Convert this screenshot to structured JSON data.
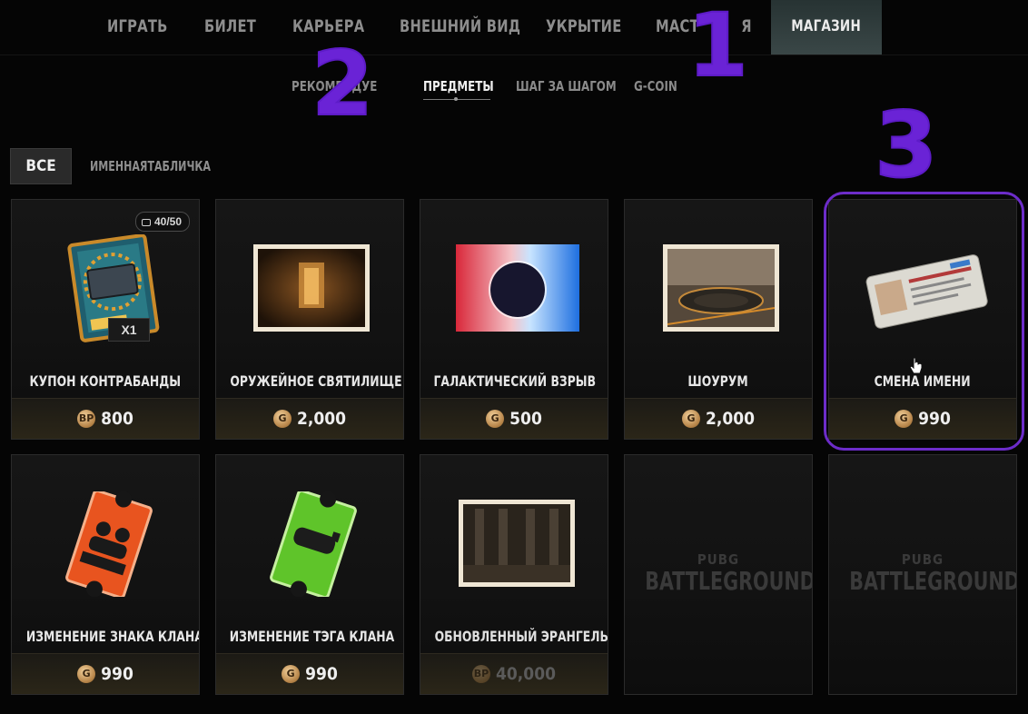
{
  "top_nav": {
    "tabs": [
      {
        "label": "ИГРАТЬ",
        "active": false
      },
      {
        "label": "БИЛЕТ",
        "active": false
      },
      {
        "label": "КАРЬЕРА",
        "active": false
      },
      {
        "label": "ВНЕШНИЙ ВИД",
        "active": false
      },
      {
        "label": "УКРЫТИЕ",
        "active": false
      },
      {
        "label": "МАСТ",
        "active": false,
        "suffix": "Я"
      },
      {
        "label": "МАГАЗИН",
        "active": true
      }
    ]
  },
  "sub_nav": {
    "tabs": [
      {
        "label": "РЕКОМЕНДУЕ",
        "active": false
      },
      {
        "label": "ПРЕДМЕТЫ",
        "active": true
      },
      {
        "label": "ШАГ ЗА ШАГОМ",
        "active": false
      },
      {
        "label": "G-COIN",
        "active": false
      }
    ]
  },
  "filters": {
    "all": "ВСЕ",
    "nameplate": "ИМЕННАЯТАБЛИЧКА"
  },
  "items": [
    {
      "name": "КУПОН КОНТРАБАНДЫ",
      "currency": "BP",
      "price": "800",
      "badge": "40/50",
      "qty": "X1"
    },
    {
      "name": "ОРУЖЕЙНОЕ СВЯТИЛИЩЕ",
      "currency": "G",
      "price": "2,000"
    },
    {
      "name": "ГАЛАКТИЧЕСКИЙ ВЗРЫВ",
      "currency": "G",
      "price": "500"
    },
    {
      "name": "ШОУРУМ",
      "currency": "G",
      "price": "2,000"
    },
    {
      "name": "СМЕНА ИМЕНИ",
      "currency": "G",
      "price": "990"
    },
    {
      "name": "ИЗМЕНЕНИЕ ЗНАКА КЛАНА",
      "currency": "G",
      "price": "990"
    },
    {
      "name": "ИЗМЕНЕНИЕ ТЭГА КЛАНА",
      "currency": "G",
      "price": "990"
    },
    {
      "name": "ОБНОВЛЕННЫЙ ЭРАНГЕЛЬ",
      "currency": "BP",
      "price": "40,000",
      "disabled": true
    }
  ],
  "placeholders": [
    {
      "small": "PUBG",
      "big": "BATTLEGROUNDS"
    },
    {
      "small": "PUBG",
      "big": "BATTLEGROUNDS"
    }
  ],
  "annotations": [
    "1",
    "2",
    "3"
  ],
  "colors": {
    "annotation": "#6a23d6",
    "active_tab": "#344141",
    "price_bar": "#2b2618"
  },
  "icons": [
    "coin-g-icon",
    "coin-bp-icon",
    "inventory-icon",
    "hand-cursor-icon"
  ]
}
